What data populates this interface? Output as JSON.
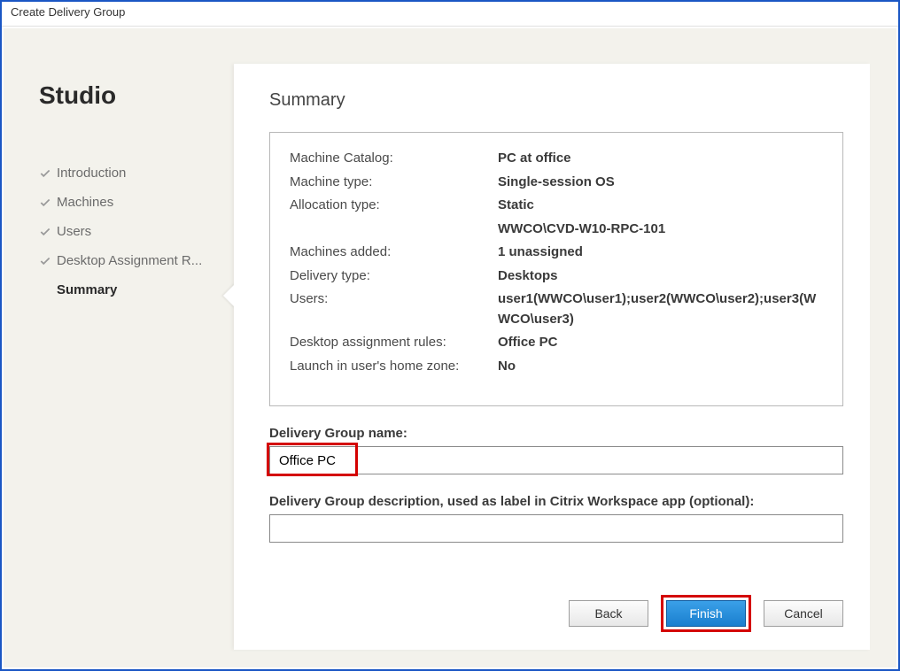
{
  "window": {
    "title": "Create Delivery Group"
  },
  "sidebar": {
    "title": "Studio",
    "steps": [
      {
        "label": "Introduction",
        "done": true,
        "active": false
      },
      {
        "label": "Machines",
        "done": true,
        "active": false
      },
      {
        "label": "Users",
        "done": true,
        "active": false
      },
      {
        "label": "Desktop Assignment R...",
        "done": true,
        "active": false
      },
      {
        "label": "Summary",
        "done": false,
        "active": true
      }
    ]
  },
  "panel": {
    "heading": "Summary",
    "rows": [
      {
        "label": "Machine Catalog:",
        "value": "PC at office"
      },
      {
        "label": "Machine type:",
        "value": "Single-session OS"
      },
      {
        "label": "Allocation type:",
        "value": "Static"
      },
      {
        "label": "",
        "value": "WWCO\\CVD-W10-RPC-101"
      },
      {
        "label": "Machines added:",
        "value": "1 unassigned"
      },
      {
        "label": "Delivery type:",
        "value": "Desktops"
      },
      {
        "label": "Users:",
        "value": "user1(WWCO\\user1);user2(WWCO\\user2);user3(WWCO\\user3)"
      },
      {
        "label": "Desktop assignment rules:",
        "value": "Office PC"
      },
      {
        "label": "Launch in user's home zone:",
        "value": "No"
      }
    ],
    "nameLabel": "Delivery Group name:",
    "nameValue": "Office PC",
    "descLabel": "Delivery Group description, used as label in Citrix Workspace app (optional):",
    "descValue": ""
  },
  "buttons": {
    "back": "Back",
    "finish": "Finish",
    "cancel": "Cancel"
  }
}
